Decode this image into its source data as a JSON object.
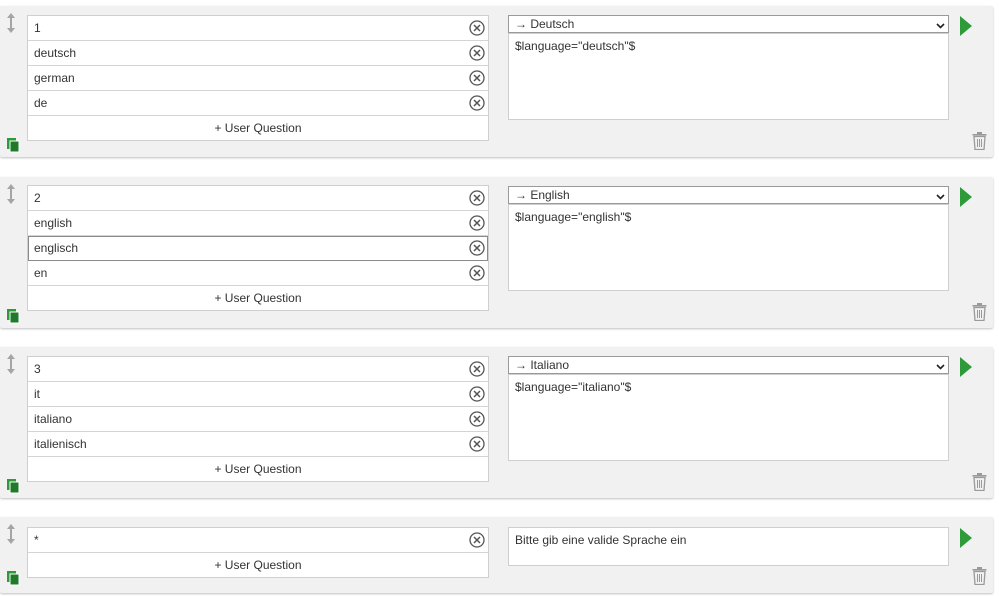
{
  "blocks": [
    {
      "questions": [
        "1",
        "deutsch",
        "german",
        "de"
      ],
      "add_label": "+ User Question",
      "target": "→ Deutsch",
      "answer": "$language=\"deutsch\"$"
    },
    {
      "questions": [
        "2",
        "english",
        "englisch",
        "en"
      ],
      "add_label": "+ User Question",
      "target": "→ English",
      "answer": "$language=\"english\"$"
    },
    {
      "questions": [
        "3",
        "it",
        "italiano",
        "italienisch"
      ],
      "add_label": "+ User Question",
      "target": "→ Italiano",
      "answer": "$language=\"italiano\"$"
    },
    {
      "questions": [
        "*"
      ],
      "add_label": "+ User Question",
      "answer": "Bitte gib eine valide Sprache ein"
    }
  ],
  "icons": {
    "drag": "drag-handle-icon",
    "copy": "copy-icon",
    "remove": "close-circle-icon",
    "caret": "chevron-down-icon",
    "play": "play-icon",
    "delete": "trash-icon"
  },
  "colors": {
    "accent_green": "#2e9a3a",
    "block_bg": "#f1f1f1",
    "icon_gray": "#9a9a9a"
  }
}
